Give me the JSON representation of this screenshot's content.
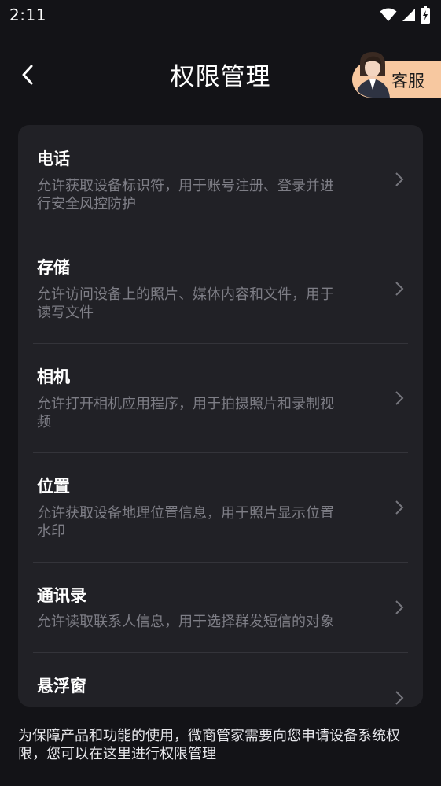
{
  "status_bar": {
    "time": "2:11",
    "icons": [
      "wifi-icon",
      "cellular-signal-icon",
      "battery-charging-icon"
    ]
  },
  "nav": {
    "back_icon": "chevron-left-icon",
    "title": "权限管理",
    "service_label": "客服"
  },
  "permissions": [
    {
      "title": "电话",
      "desc_lines": [
        "允许获取设备标识符，用于账号注册、登录并进",
        "行安全风控防护"
      ]
    },
    {
      "title": "存储",
      "desc_lines": [
        "允许访问设备上的照片、媒体内容和文件，用于",
        "读写文件"
      ]
    },
    {
      "title": "相机",
      "desc_lines": [
        "允许打开相机应用程序，用于拍摄照片和录制视",
        "频"
      ]
    },
    {
      "title": "位置",
      "desc_lines": [
        "允许获取设备地理位置信息，用于照片显示位置",
        "水印"
      ]
    },
    {
      "title": "通讯录",
      "desc_lines": [
        "允许读取联系人信息，用于选择群发短信的对象"
      ]
    },
    {
      "title": "悬浮窗",
      "desc_lines": []
    }
  ],
  "footer": {
    "note_lines": [
      "为保障产品和功能的使用，微商管家需要向您申请设备系统权",
      "限，您可以在这里进行权限管理"
    ]
  },
  "colors": {
    "background": "#131317",
    "card": "#212126",
    "service_button": "#f7c8a0",
    "description_text": "#7e7e86"
  }
}
